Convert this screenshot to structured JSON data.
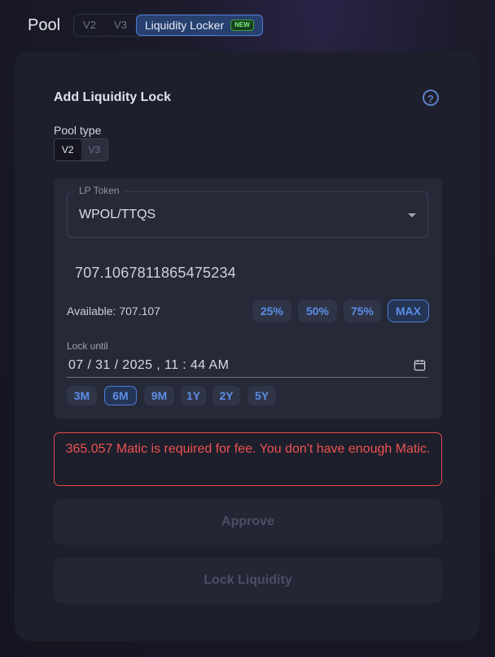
{
  "header": {
    "title": "Pool",
    "tabs": [
      {
        "label": "V2"
      },
      {
        "label": "V3"
      },
      {
        "label": "Liquidity Locker",
        "badge": "NEW",
        "active": true
      }
    ]
  },
  "card": {
    "heading": "Add Liquidity Lock",
    "help_symbol": "?",
    "pool_type": {
      "label": "Pool type",
      "options": [
        "V2",
        "V3"
      ],
      "selected": "V2"
    },
    "lp_token": {
      "label": "LP Token",
      "value": "WPOL/TTQS"
    },
    "amount": "707.1067811865475234",
    "available": "Available: 707.107",
    "percent_buttons": [
      "25%",
      "50%",
      "75%",
      "MAX"
    ],
    "percent_selected": "MAX",
    "lock_until": {
      "label": "Lock until",
      "value": "07 / 31 / 2025 ,  11 : 44   AM"
    },
    "duration_buttons": [
      "3M",
      "6M",
      "9M",
      "1Y",
      "2Y",
      "5Y"
    ],
    "duration_selected": "6M",
    "error": "365.057 Matic is required for fee. You don't have enough Matic.",
    "approve_label": "Approve",
    "lock_label": "Lock Liquidity"
  },
  "colors": {
    "accent": "#4b80db",
    "error": "#ef5151",
    "new_badge": "#7ef07c"
  }
}
